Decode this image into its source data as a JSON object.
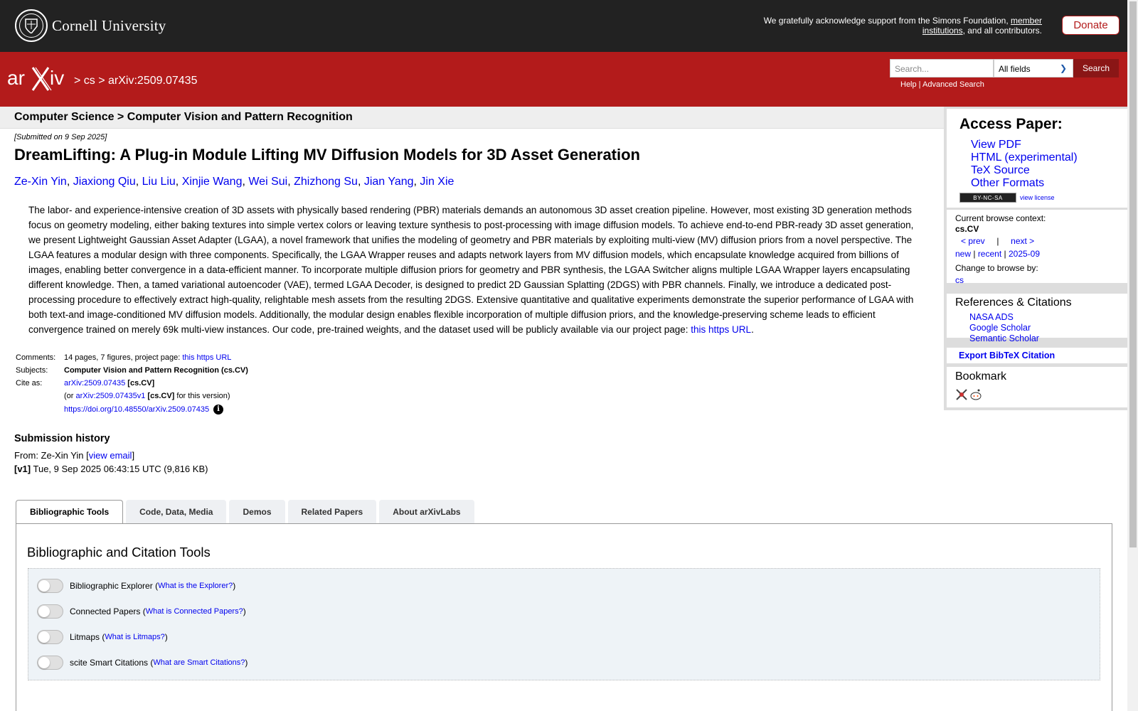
{
  "topbar": {
    "university": "Cornell University",
    "ack_text": "We gratefully acknowledge support from the Simons Foundation, ",
    "ack_link": "member institutions",
    "ack_tail": ", and all contributors.",
    "donate": "Donate"
  },
  "header": {
    "breadcrumb_cs": "cs",
    "breadcrumb_id": "arXiv:2509.07435",
    "search_placeholder": "Search...",
    "field_select": "All fields",
    "search_button": "Search",
    "help": "Help",
    "advanced": "Advanced Search"
  },
  "category_bar": "Computer Science > Computer Vision and Pattern Recognition",
  "paper": {
    "submitted": "[Submitted on 9 Sep 2025]",
    "title": "DreamLifting: A Plug-in Module Lifting MV Diffusion Models for 3D Asset Generation",
    "authors": [
      "Ze-Xin Yin",
      "Jiaxiong Qiu",
      "Liu Liu",
      "Xinjie Wang",
      "Wei Sui",
      "Zhizhong Su",
      "Jian Yang",
      "Jin Xie"
    ],
    "abstract": "The labor- and experience-intensive creation of 3D assets with physically based rendering (PBR) materials demands an autonomous 3D asset creation pipeline. However, most existing 3D generation methods focus on geometry modeling, either baking textures into simple vertex colors or leaving texture synthesis to post-processing with image diffusion models. To achieve end-to-end PBR-ready 3D asset generation, we present Lightweight Gaussian Asset Adapter (LGAA), a novel framework that unifies the modeling of geometry and PBR materials by exploiting multi-view (MV) diffusion priors from a novel perspective. The LGAA features a modular design with three components. Specifically, the LGAA Wrapper reuses and adapts network layers from MV diffusion models, which encapsulate knowledge acquired from billions of images, enabling better convergence in a data-efficient manner. To incorporate multiple diffusion priors for geometry and PBR synthesis, the LGAA Switcher aligns multiple LGAA Wrapper layers encapsulating different knowledge. Then, a tamed variational autoencoder (VAE), termed LGAA Decoder, is designed to predict 2D Gaussian Splatting (2DGS) with PBR channels. Finally, we introduce a dedicated post-processing procedure to effectively extract high-quality, relightable mesh assets from the resulting 2DGS. Extensive quantitative and qualitative experiments demonstrate the superior performance of LGAA with both text-and image-conditioned MV diffusion models. Additionally, the modular design enables flexible incorporation of multiple diffusion priors, and the knowledge-preserving scheme leads to efficient convergence trained on merely 69k multi-view instances. Our code, pre-trained weights, and the dataset used will be publicly available via our project page: ",
    "abstract_link": "this https URL",
    "abstract_end": ".",
    "comments_label": "Comments:",
    "comments": "14 pages, 7 figures, project page: ",
    "comments_link": "this https URL",
    "subjects_label": "Subjects:",
    "subjects": "Computer Vision and Pattern Recognition (cs.CV)",
    "cite_label": "Cite as:",
    "cite_id": "arXiv:2509.07435",
    "cite_cat": "[cs.CV]",
    "cite_or": "(or ",
    "cite_v1": "arXiv:2509.07435v1",
    "cite_v1_cat": "[cs.CV]",
    "cite_v1_tail": " for this version)",
    "doi": "https://doi.org/10.48550/arXiv.2509.07435"
  },
  "history": {
    "heading": "Submission history",
    "from_prefix": "From: Ze-Xin Yin [",
    "view_email": "view email",
    "from_suffix": "]",
    "v1_label": "[v1]",
    "v1_text": " Tue, 9 Sep 2025 06:43:15 UTC (9,816 KB)"
  },
  "tabs": [
    "Bibliographic Tools",
    "Code, Data, Media",
    "Demos",
    "Related Papers",
    "About arXivLabs"
  ],
  "panel": {
    "title": "Bibliographic and Citation Tools",
    "tools": [
      {
        "name": "Bibliographic Explorer",
        "link": "What is the Explorer?"
      },
      {
        "name": "Connected Papers",
        "link": "What is Connected Papers?"
      },
      {
        "name": "Litmaps",
        "link": "What is Litmaps?"
      },
      {
        "name": "scite Smart Citations",
        "link": "What are Smart Citations?"
      }
    ]
  },
  "sidebar": {
    "access_heading": "Access Paper:",
    "access_links": [
      "View PDF",
      "HTML (experimental)",
      "TeX Source",
      "Other Formats"
    ],
    "license_badge": "BY-NC-SA",
    "view_license": "view license",
    "context_label": "Current browse context:",
    "context_value": "cs.CV",
    "prev": "< prev",
    "sep": "|",
    "next": "next >",
    "new": "new",
    "recent": "recent",
    "month": "2025-09",
    "change_label": "Change to browse by:",
    "change_cs": "cs",
    "refs_heading": "References & Citations",
    "refs": [
      "NASA ADS",
      "Google Scholar",
      "Semantic Scholar"
    ],
    "export": "Export BibTeX Citation",
    "bookmark": "Bookmark"
  }
}
